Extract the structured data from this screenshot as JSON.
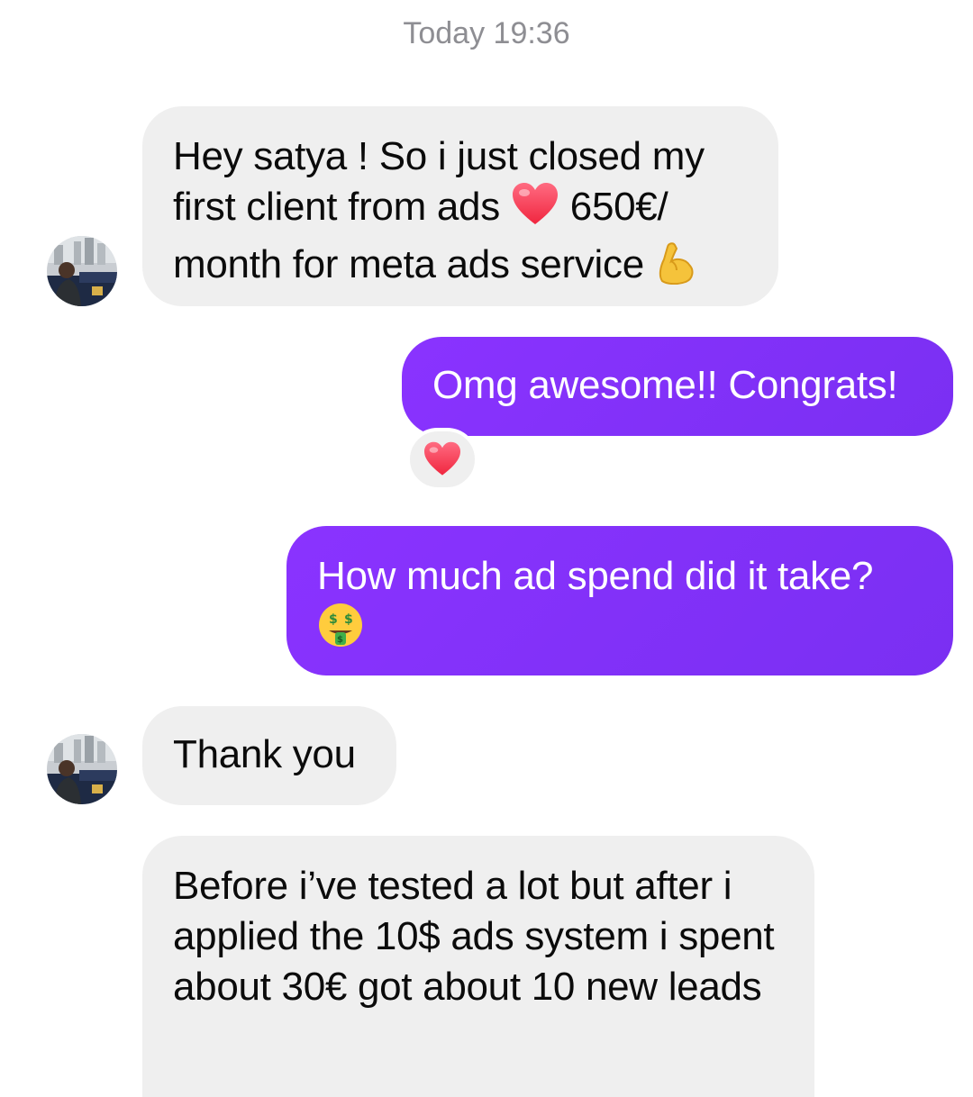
{
  "timestamp": "Today 19:36",
  "messages": [
    {
      "id": "msg1",
      "direction": "incoming",
      "parts": [
        "Hey satya ! So i just closed my first client from ads ",
        " 650€/ month for meta ads service "
      ],
      "emojis": [
        "red-heart-emoji",
        "flexed-biceps-emoji"
      ]
    },
    {
      "id": "msg2",
      "direction": "outgoing",
      "text": "Omg awesome!! Congrats!",
      "reaction": "red-heart-emoji"
    },
    {
      "id": "msg3",
      "direction": "outgoing",
      "text": "How much ad spend did it take?",
      "emojis": [
        "money-mouth-face-emoji"
      ]
    },
    {
      "id": "msg4",
      "direction": "incoming",
      "text": "Thank you"
    },
    {
      "id": "msg5",
      "direction": "incoming",
      "text": "Before i’ve tested a lot but after i applied the 10$ ads system i spent about 30€ got about 10 new leads"
    }
  ],
  "colors": {
    "incoming_bubble": "#efefef",
    "outgoing_bubble": "#8a33ff",
    "timestamp_text": "#8e8e93"
  }
}
